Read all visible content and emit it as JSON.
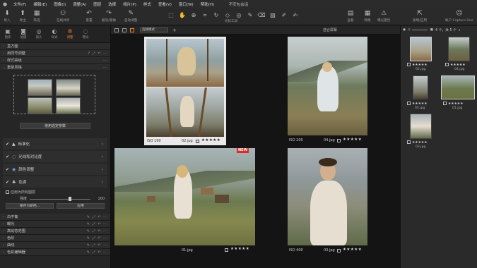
{
  "window": {
    "title": "不安包会话"
  },
  "menu": [
    "文件(F)",
    "编辑(E)",
    "图像(I)",
    "调整(A)",
    "图层",
    "选择",
    "相片(P)",
    "样式",
    "查看(V)",
    "窗口(W)",
    "帮助(H)"
  ],
  "toolbar": {
    "left": [
      {
        "icon": "import-icon",
        "glyph": "⬇",
        "label": "导入"
      },
      {
        "icon": "export-icon",
        "glyph": "⬆",
        "label": "导出"
      },
      {
        "icon": "filter-icon",
        "glyph": "▦",
        "label": "筛选"
      },
      {
        "icon": "share-icon",
        "glyph": "⚇",
        "label": "在线共享"
      },
      {
        "icon": "reset-icon",
        "glyph": "↶",
        "label": "重置"
      },
      {
        "icon": "undo-redo-icon",
        "glyph": "↷",
        "label": "撤消/重做"
      },
      {
        "icon": "auto-adjust-icon",
        "glyph": "✎",
        "label": "自动调整"
      }
    ],
    "tools_label": "光标工具",
    "right": [
      {
        "icon": "layout-icon",
        "glyph": "▤",
        "label": "查看"
      },
      {
        "icon": "grid-icon",
        "glyph": "▦",
        "label": "网格"
      },
      {
        "icon": "warning-icon",
        "glyph": "⚠",
        "label": "曝光警告"
      },
      {
        "icon": "copy-apply-icon",
        "glyph": "⇱",
        "label": "复制/应用"
      },
      {
        "icon": "account-icon",
        "glyph": "☺",
        "label": "帐户 Capture One"
      }
    ]
  },
  "left_panel": {
    "tabs": [
      {
        "icon": "library-icon",
        "label": "图库"
      },
      {
        "icon": "capture-icon",
        "label": "拍摄"
      },
      {
        "icon": "lens-icon",
        "label": "镜头"
      },
      {
        "icon": "style-icon",
        "label": "样式"
      },
      {
        "icon": "adjust-icon",
        "label": "调整"
      },
      {
        "icon": "exposure-icon",
        "label": "曝光"
      }
    ],
    "sections": [
      {
        "label": "直方图"
      },
      {
        "label": "用同号调整"
      },
      {
        "label": "样式高级"
      },
      {
        "label": "重复风格"
      }
    ],
    "style_button": "使用选定参数",
    "adjustments": [
      {
        "icon": "▲",
        "label": "标准化",
        "color": "#cfcfcf"
      },
      {
        "icon": "◌",
        "label": "光线和对比度",
        "color": "#cfcfcf"
      },
      {
        "icon": "◉",
        "label": "颜色调整",
        "color": "#6fa3e8"
      },
      {
        "icon": "♣",
        "label": "色调",
        "color": "#cfcfcf"
      }
    ],
    "apply_to_all": "应用为所有图层",
    "strength": {
      "label": "强度",
      "value": "100"
    },
    "buttons": {
      "save": "保存为新档...",
      "apply": "应用"
    },
    "bottom_sections": [
      "白平衡",
      "曝光",
      "高动态范围",
      "色阶",
      "曲线",
      "色彩编辑器"
    ]
  },
  "viewer": {
    "dropdown": "选择模式",
    "workspace": "选合屏幕",
    "images": [
      {
        "caption_left": "ISO 160",
        "caption_right": "02.jpg",
        "stars": "★★★★★"
      },
      {
        "caption_left": "ISO 200",
        "caption_right": "04.jpg",
        "stars": "★★★★★"
      },
      {
        "caption_left": "",
        "caption_right": "01.jpg",
        "stars": "★★★★★",
        "badge": "NEW"
      },
      {
        "caption_left": "ISO 400",
        "caption_right": "03.jpg",
        "stars": "★★★★★"
      }
    ]
  },
  "browser": {
    "count": "4 个，共 5 个",
    "items": [
      {
        "name": "02.jpg",
        "stars": "★★★★★"
      },
      {
        "name": "04.jpg",
        "stars": "★★★★★"
      },
      {
        "name": "05.jpg",
        "stars": "★★★★★"
      },
      {
        "name": "01.jpg",
        "stars": "★★★★★"
      },
      {
        "name": "03.jpg",
        "stars": "★★★★★"
      }
    ]
  },
  "colors": {
    "accent": "#e8852a",
    "badge": "#d62e2e",
    "panel": "#262626",
    "viewer_bg": "#141414"
  }
}
